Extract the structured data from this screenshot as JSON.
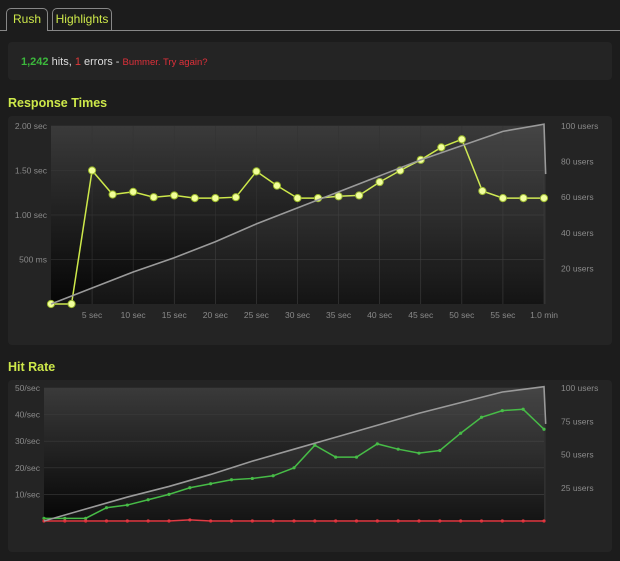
{
  "tabs": [
    {
      "label": "Rush",
      "active": true
    },
    {
      "label": "Highlights",
      "active": false
    }
  ],
  "summary": {
    "hits": "1,242",
    "hits_text": " hits, ",
    "errors": "1",
    "errors_text": " errors - ",
    "message": "Bummer. Try again?"
  },
  "colors": {
    "accent": "#cde84a",
    "hits_green": "#3cb83c",
    "error_red": "#e0303a",
    "users_line": "#9a9a9a"
  },
  "response_times": {
    "title": "Response Times",
    "chart_data": {
      "type": "line",
      "x_ticks": [
        "5 sec",
        "10 sec",
        "15 sec",
        "20 sec",
        "25 sec",
        "30 sec",
        "35 sec",
        "40 sec",
        "45 sec",
        "50 sec",
        "55 sec",
        "1.0 min"
      ],
      "y_left_ticks": [
        "500 ms",
        "1.00 sec",
        "1.50 sec",
        "2.00 sec"
      ],
      "y_right_ticks": [
        "20 users",
        "40 users",
        "60 users",
        "80 users",
        "100 users"
      ],
      "ylim_left": [
        0,
        2.0
      ],
      "ylim_right": [
        0,
        100
      ],
      "xlim": [
        0,
        60
      ],
      "series": [
        {
          "name": "",
          "axis": "left",
          "color": "#cde84a",
          "x": [
            0,
            2.5,
            5,
            7.5,
            10,
            12.5,
            15,
            17.5,
            20,
            22.5,
            25,
            27.5,
            30,
            32.5,
            35,
            37.5,
            40,
            42.5,
            45,
            47.5,
            50,
            52.5,
            55,
            57.5,
            60
          ],
          "y": [
            0,
            0,
            1.5,
            1.23,
            1.26,
            1.2,
            1.22,
            1.19,
            1.19,
            1.2,
            1.49,
            1.33,
            1.19,
            1.19,
            1.21,
            1.22,
            1.37,
            1.5,
            1.62,
            1.76,
            1.85,
            1.27,
            1.19,
            1.19,
            1.19
          ]
        },
        {
          "name": "",
          "axis": "right",
          "color": "#9a9a9a",
          "x": [
            0,
            5,
            10,
            15,
            20,
            25,
            30,
            35,
            40,
            45,
            50,
            55,
            60,
            60.2
          ],
          "y": [
            0,
            9,
            18,
            26,
            35,
            45,
            54,
            63,
            72,
            81,
            89,
            97,
            101,
            73
          ]
        }
      ]
    }
  },
  "hit_rate": {
    "title": "Hit Rate",
    "chart_data": {
      "type": "line",
      "y_left_ticks": [
        "10/sec",
        "20/sec",
        "30/sec",
        "40/sec",
        "50/sec"
      ],
      "y_right_ticks": [
        "25 users",
        "50 users",
        "75 users",
        "100 users"
      ],
      "ylim_left": [
        0,
        50
      ],
      "ylim_right": [
        0,
        100
      ],
      "xlim": [
        0,
        60
      ],
      "series": [
        {
          "name": "",
          "axis": "left",
          "color": "#3cb83c",
          "x": [
            0,
            2.5,
            5,
            7.5,
            10,
            12.5,
            15,
            17.5,
            20,
            22.5,
            25,
            27.5,
            30,
            32.5,
            35,
            37.5,
            40,
            42.5,
            45,
            47.5,
            50,
            52.5,
            55,
            57.5,
            60
          ],
          "y": [
            1,
            1,
            1,
            5,
            6,
            8,
            10,
            12.5,
            14,
            15.5,
            16,
            17,
            20,
            28.5,
            24,
            24,
            29,
            27,
            25.5,
            26.5,
            33,
            39,
            41.5,
            42,
            34.5
          ]
        },
        {
          "name": "",
          "axis": "left",
          "color": "#e0303a",
          "x": [
            0,
            2.5,
            5,
            7.5,
            10,
            12.5,
            15,
            17.5,
            20,
            22.5,
            25,
            27.5,
            30,
            32.5,
            35,
            37.5,
            40,
            42.5,
            45,
            47.5,
            50,
            52.5,
            55,
            57.5,
            60
          ],
          "y": [
            0,
            0,
            0,
            0,
            0,
            0,
            0,
            0.4,
            0,
            0,
            0,
            0,
            0,
            0,
            0,
            0,
            0,
            0,
            0,
            0,
            0,
            0,
            0,
            0,
            0
          ]
        },
        {
          "name": "",
          "axis": "right",
          "color": "#9a9a9a",
          "x": [
            0,
            5,
            10,
            15,
            20,
            25,
            30,
            35,
            40,
            45,
            50,
            55,
            60,
            60.2
          ],
          "y": [
            0,
            9,
            18,
            26,
            35,
            45,
            54,
            63,
            72,
            81,
            89,
            97,
            101,
            73
          ]
        }
      ]
    }
  }
}
